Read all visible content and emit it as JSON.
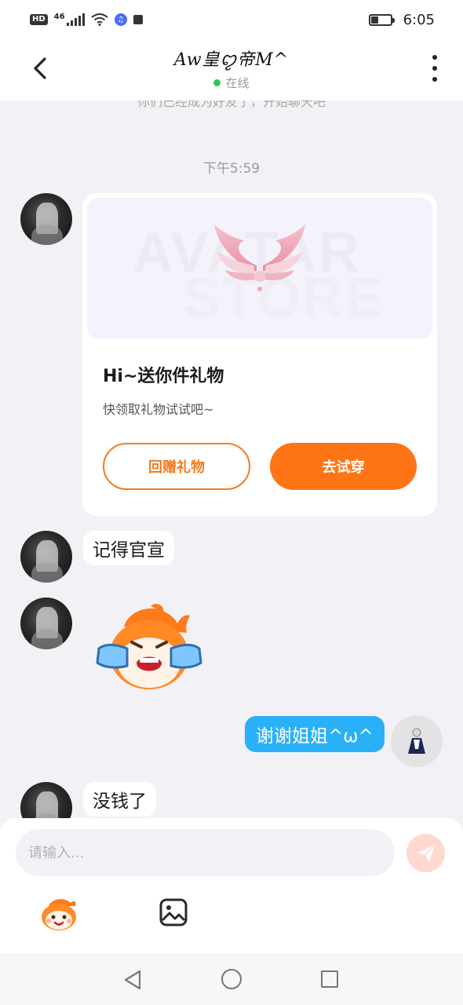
{
  "status_bar": {
    "hd": "HD",
    "network": "46",
    "time": "6:05",
    "battery_level": 0.4
  },
  "header": {
    "title": "Aw皇ꨄ︎帝M^",
    "status": "在线"
  },
  "chat": {
    "system_note": "你们已经成为好友了，开始聊天吧",
    "time_label": "下午5:59",
    "gift_card": {
      "banner_text_1": "AVATAR",
      "banner_text_2": "STORE",
      "title": "Hi~送你件礼物",
      "subtitle": "快领取礼物试试吧~",
      "return_button": "回赠礼物",
      "try_button": "去试穿"
    },
    "messages": [
      {
        "from": "them",
        "text": "记得官宣"
      },
      {
        "from": "them",
        "text": ""
      },
      {
        "from": "me",
        "text": "谢谢姐姐^ω^"
      },
      {
        "from": "them",
        "text": "没钱了"
      }
    ]
  },
  "input": {
    "placeholder": "请输入..."
  },
  "icons": {
    "back": "chevron-left-icon",
    "more": "more-vertical-icon",
    "send": "paper-plane-icon",
    "emoji": "emoji-sticker-icon",
    "image": "image-icon"
  },
  "colors": {
    "accent": "#ff7416",
    "outgoing_bubble": "#2ab0f7",
    "online": "#2ec55a"
  }
}
